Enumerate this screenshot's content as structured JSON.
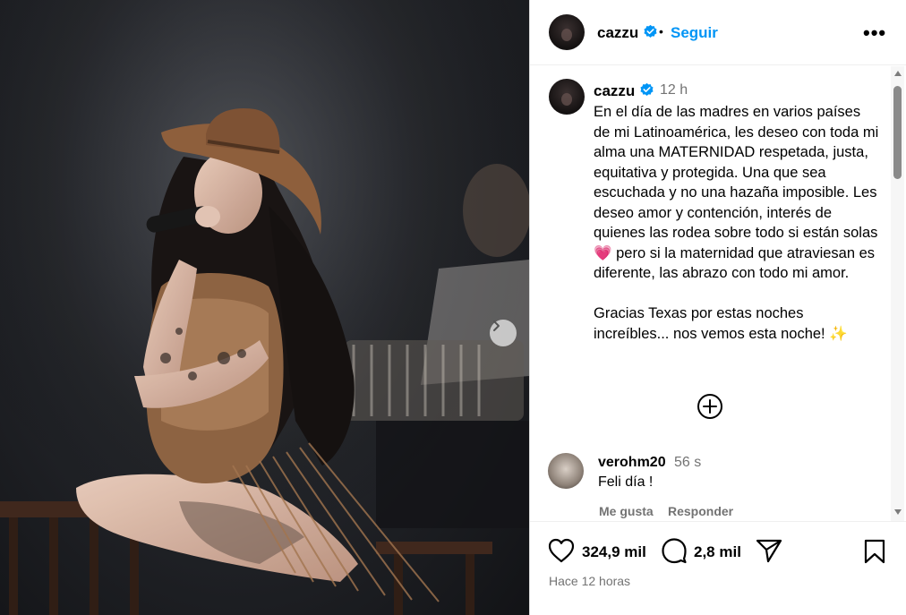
{
  "photo": {
    "description_icon": "chevron-right-icon"
  },
  "header": {
    "username": "cazzu",
    "separator": "•",
    "follow_label": "Seguir",
    "more_label": "•••"
  },
  "post": {
    "username": "cazzu",
    "time": "12 h",
    "caption": "En el día de las madres en varios países de mi Latinoamérica, les deseo con toda mi alma una MATERNIDAD respetada, justa, equitativa y protegida. Una que sea escuchada y no una hazaña imposible. Les deseo amor y contención, interés de quienes las rodea sobre todo si están solas 💗 pero si la maternidad que atraviesan es diferente, las abrazo con todo mi amor.\n\nGracias Texas por estas noches increíbles... nos vemos esta noche! ✨"
  },
  "comment": {
    "username": "verohm20",
    "time": "56 s",
    "text": "Feli día !",
    "like_label": "Me gusta",
    "reply_label": "Responder"
  },
  "actions": {
    "likes": "324,9 mil",
    "comments": "2,8 mil",
    "posted": "Hace 12 horas"
  },
  "colors": {
    "accent": "#0095f6",
    "verified": "#0095f6",
    "muted": "#737373"
  }
}
